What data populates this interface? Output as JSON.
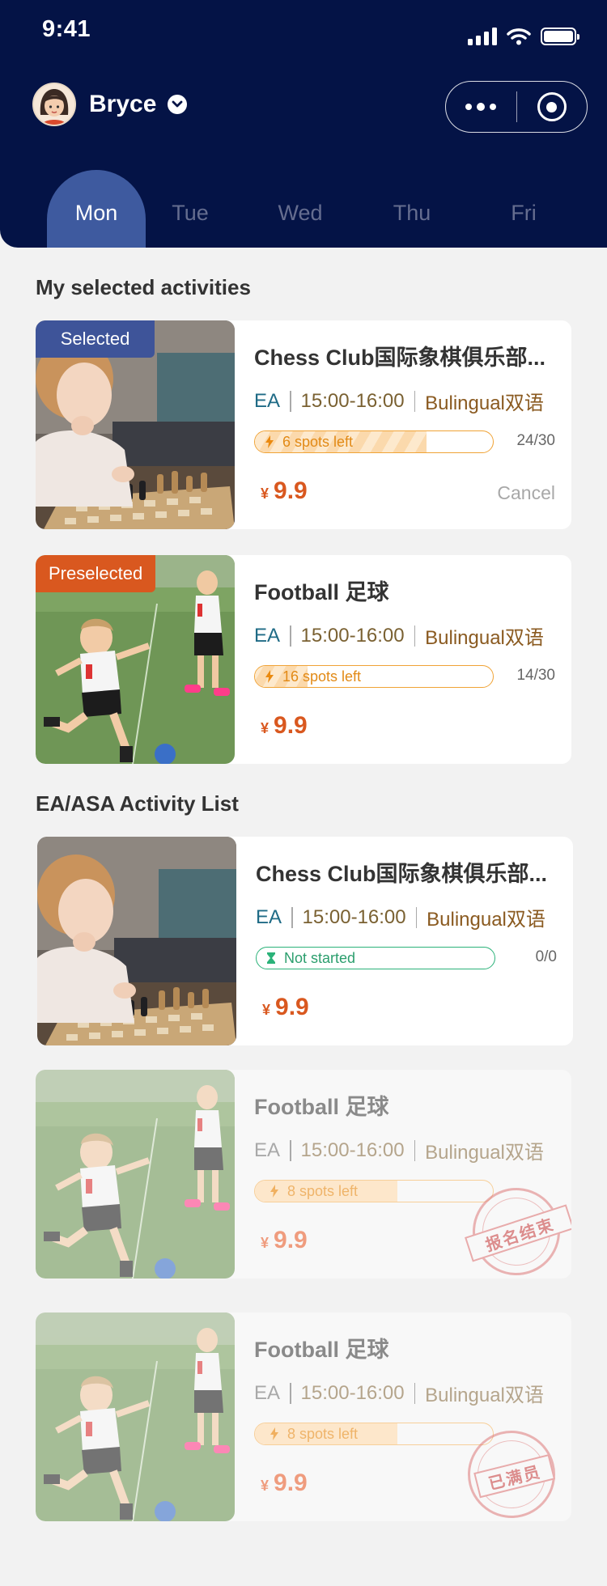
{
  "status_bar": {
    "time": "9:41"
  },
  "user": {
    "name": "Bryce"
  },
  "days": [
    "Mon",
    "Tue",
    "Wed",
    "Thu",
    "Fri"
  ],
  "active_day": "Mon",
  "sections": {
    "selected_title": "My selected activities",
    "list_title": "EA/ASA Activity List"
  },
  "selected": [
    {
      "tag": "Selected",
      "title": "Chess Club国际象棋俱乐部...",
      "category": "EA",
      "time": "15:00-16:00",
      "language": "Bulingual双语",
      "spots": "6 spots left",
      "count": "24/30",
      "progress": 0.72,
      "currency": "¥",
      "price": "9.9",
      "cancel": "Cancel",
      "image": "chess"
    },
    {
      "tag": "Preselected",
      "title": "Football 足球",
      "category": "EA",
      "time": "15:00-16:00",
      "language": "Bulingual双语",
      "spots": "16 spots left",
      "count": "14/30",
      "progress": 0.22,
      "currency": "¥",
      "price": "9.9",
      "image": "football"
    }
  ],
  "activities": [
    {
      "title": "Chess Club国际象棋俱乐部...",
      "category": "EA",
      "time": "15:00-16:00",
      "language": "Bulingual双语",
      "status": "Not started",
      "count": "0/0",
      "currency": "¥",
      "price": "9.9",
      "image": "chess"
    },
    {
      "title": "Football 足球",
      "category": "EA",
      "time": "15:00-16:00",
      "language": "Bulingual双语",
      "spots": "8 spots left",
      "progress": 0.6,
      "currency": "¥",
      "price": "9.9",
      "stamp": "报名结束",
      "image": "football"
    },
    {
      "title": "Football 足球",
      "category": "EA",
      "time": "15:00-16:00",
      "language": "Bulingual双语",
      "spots": "8 spots left",
      "progress": 0.6,
      "currency": "¥",
      "price": "9.9",
      "stamp": "已满员",
      "image": "football"
    }
  ],
  "icons": {
    "user_dropdown": "chevron-down-icon",
    "more": "more-icon",
    "record": "record-icon",
    "spots": "lightning-icon",
    "not_started": "hourglass-icon"
  },
  "colors": {
    "header_bg": "#041346",
    "active_tab": "#3e5a9f",
    "price": "#d9581f",
    "spots_orange": "#f0a336",
    "not_started_green": "#2bb279",
    "selected_tag": "#3e5499",
    "preselected_tag": "#d9581f"
  }
}
